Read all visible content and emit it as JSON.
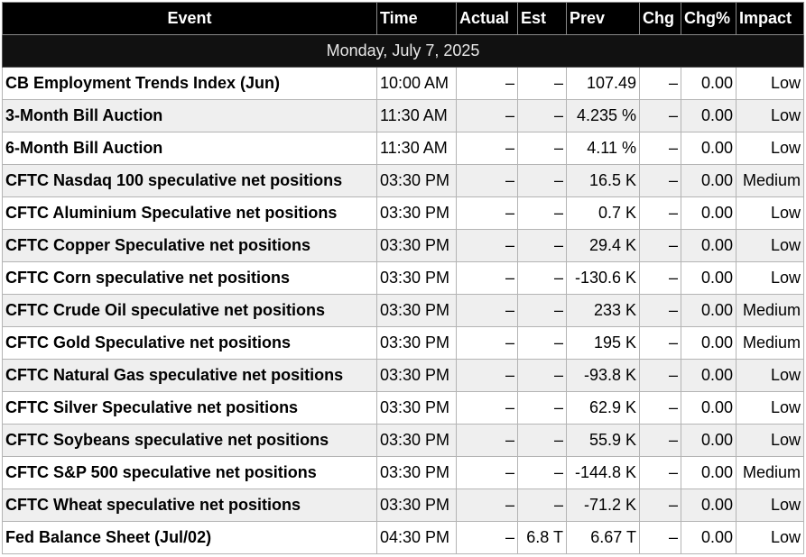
{
  "headers": {
    "event": "Event",
    "time": "Time",
    "actual": "Actual",
    "est": "Est",
    "prev": "Prev",
    "chg": "Chg",
    "chg_pct": "Chg%",
    "impact": "Impact"
  },
  "date_label": "Monday, July 7, 2025",
  "rows": [
    {
      "event": "CB Employment Trends Index (Jun)",
      "time": "10:00 AM",
      "actual": "–",
      "est": "–",
      "prev": "107.49",
      "chg": "–",
      "chg_pct": "0.00",
      "impact": "Low"
    },
    {
      "event": "3-Month Bill Auction",
      "time": "11:30 AM",
      "actual": "–",
      "est": "–",
      "prev": "4.235 %",
      "chg": "–",
      "chg_pct": "0.00",
      "impact": "Low"
    },
    {
      "event": "6-Month Bill Auction",
      "time": "11:30 AM",
      "actual": "–",
      "est": "–",
      "prev": "4.11 %",
      "chg": "–",
      "chg_pct": "0.00",
      "impact": "Low"
    },
    {
      "event": "CFTC Nasdaq 100 speculative net positions",
      "time": "03:30 PM",
      "actual": "–",
      "est": "–",
      "prev": "16.5 K",
      "chg": "–",
      "chg_pct": "0.00",
      "impact": "Medium"
    },
    {
      "event": "CFTC Aluminium Speculative net positions",
      "time": "03:30 PM",
      "actual": "–",
      "est": "–",
      "prev": "0.7 K",
      "chg": "–",
      "chg_pct": "0.00",
      "impact": "Low"
    },
    {
      "event": "CFTC Copper Speculative net positions",
      "time": "03:30 PM",
      "actual": "–",
      "est": "–",
      "prev": "29.4 K",
      "chg": "–",
      "chg_pct": "0.00",
      "impact": "Low"
    },
    {
      "event": "CFTC Corn speculative net positions",
      "time": "03:30 PM",
      "actual": "–",
      "est": "–",
      "prev": "-130.6 K",
      "chg": "–",
      "chg_pct": "0.00",
      "impact": "Low"
    },
    {
      "event": "CFTC Crude Oil speculative net positions",
      "time": "03:30 PM",
      "actual": "–",
      "est": "–",
      "prev": "233 K",
      "chg": "–",
      "chg_pct": "0.00",
      "impact": "Medium"
    },
    {
      "event": "CFTC Gold Speculative net positions",
      "time": "03:30 PM",
      "actual": "–",
      "est": "–",
      "prev": "195 K",
      "chg": "–",
      "chg_pct": "0.00",
      "impact": "Medium"
    },
    {
      "event": "CFTC Natural Gas speculative net positions",
      "time": "03:30 PM",
      "actual": "–",
      "est": "–",
      "prev": "-93.8 K",
      "chg": "–",
      "chg_pct": "0.00",
      "impact": "Low"
    },
    {
      "event": "CFTC Silver Speculative net positions",
      "time": "03:30 PM",
      "actual": "–",
      "est": "–",
      "prev": "62.9 K",
      "chg": "–",
      "chg_pct": "0.00",
      "impact": "Low"
    },
    {
      "event": "CFTC Soybeans speculative net positions",
      "time": "03:30 PM",
      "actual": "–",
      "est": "–",
      "prev": "55.9 K",
      "chg": "–",
      "chg_pct": "0.00",
      "impact": "Low"
    },
    {
      "event": "CFTC S&P 500 speculative net positions",
      "time": "03:30 PM",
      "actual": "–",
      "est": "–",
      "prev": "-144.8 K",
      "chg": "–",
      "chg_pct": "0.00",
      "impact": "Medium"
    },
    {
      "event": "CFTC Wheat speculative net positions",
      "time": "03:30 PM",
      "actual": "–",
      "est": "–",
      "prev": "-71.2 K",
      "chg": "–",
      "chg_pct": "0.00",
      "impact": "Low"
    },
    {
      "event": "Fed Balance Sheet (Jul/02)",
      "time": "04:30 PM",
      "actual": "–",
      "est": "6.8 T",
      "prev": "6.67 T",
      "chg": "–",
      "chg_pct": "0.00",
      "impact": "Low"
    }
  ]
}
